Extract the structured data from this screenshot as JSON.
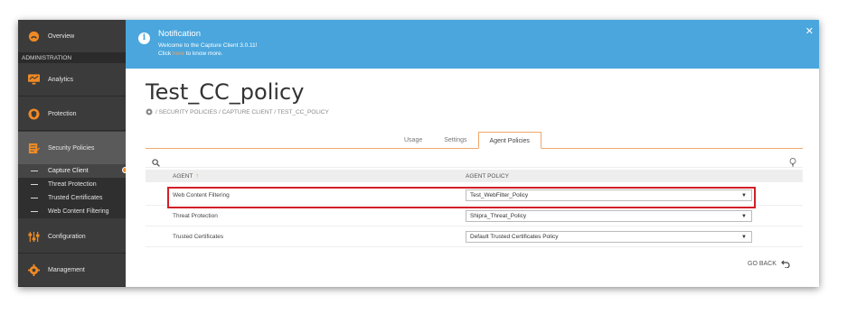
{
  "sidebar": {
    "overview_label": "Overview",
    "admin_label": "ADMINISTRATION",
    "items": [
      {
        "label": "Analytics"
      },
      {
        "label": "Protection"
      },
      {
        "label": "Security Policies"
      },
      {
        "label": "Configuration"
      },
      {
        "label": "Management"
      }
    ],
    "subitems": [
      {
        "label": "Capture Client"
      },
      {
        "label": "Threat Protection"
      },
      {
        "label": "Trusted Certificates"
      },
      {
        "label": "Web Content Filtering"
      }
    ]
  },
  "notification": {
    "title": "Notification",
    "message": "Welcome to the Capture Client 3.0.11!",
    "click_prefix": "Click",
    "link_text": "here",
    "click_suffix": "to know more.",
    "close": "✕"
  },
  "page": {
    "title": "Test_CC_policy",
    "breadcrumb": "/ SECURITY POLICIES / CAPTURE CLIENT / TEST_CC_POLICY"
  },
  "tabs": [
    {
      "label": "Usage"
    },
    {
      "label": "Settings"
    },
    {
      "label": "Agent Policies"
    }
  ],
  "table": {
    "col_agent": "AGENT",
    "col_policy": "AGENT POLICY",
    "sort_arrow": "↑",
    "rows": [
      {
        "agent": "Web Content Filtering",
        "policy": "Test_WebFilter_Policy"
      },
      {
        "agent": "Threat Protection",
        "policy": "Shipra_Threat_Policy"
      },
      {
        "agent": "Trusted Certificates",
        "policy": "Default Trusted Certificates Policy"
      }
    ],
    "caret": "▼"
  },
  "footer": {
    "go_back": "GO BACK"
  },
  "colors": {
    "accent": "#f08a24",
    "notification_bg": "#4aa6dd",
    "highlight": "#d31f27",
    "sidebar_bg": "#3b3b3b"
  }
}
